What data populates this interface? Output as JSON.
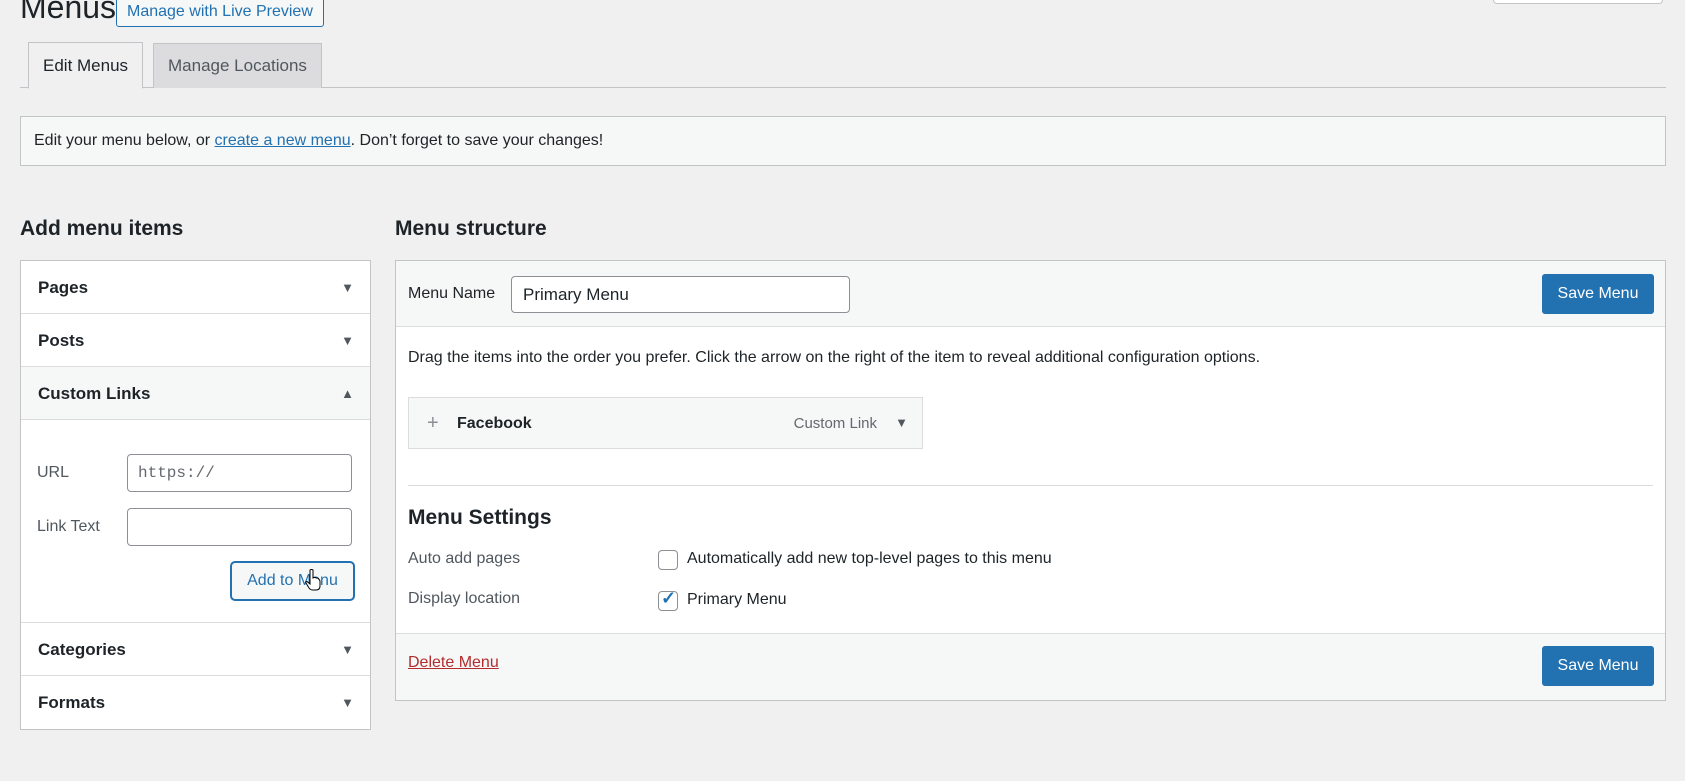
{
  "header": {
    "title": "Menus",
    "live_preview_label": "Manage with Live Preview"
  },
  "tabs": [
    {
      "label": "Edit Menus",
      "active": true
    },
    {
      "label": "Manage Locations",
      "active": false
    }
  ],
  "notice": {
    "prefix": "Edit your menu below, or ",
    "link": "create a new menu",
    "suffix": ". Don’t forget to save your changes!"
  },
  "add_items": {
    "title": "Add menu items",
    "sections": {
      "pages": "Pages",
      "posts": "Posts",
      "custom_links": "Custom Links",
      "categories": "Categories",
      "formats": "Formats"
    },
    "custom_links": {
      "url_label": "URL",
      "url_placeholder": "https://",
      "link_text_label": "Link Text",
      "link_text_value": "",
      "add_button": "Add to Menu"
    }
  },
  "menu_structure": {
    "title": "Menu structure",
    "menu_name_label": "Menu Name",
    "menu_name_value": "Primary Menu",
    "save_label": "Save Menu",
    "instructions": "Drag the items into the order you prefer. Click the arrow on the right of the item to reveal additional configuration options.",
    "items": [
      {
        "title": "Facebook",
        "type": "Custom Link"
      }
    ],
    "settings": {
      "title": "Menu Settings",
      "auto_add_label": "Auto add pages",
      "auto_add_text": "Automatically add new top-level pages to this menu",
      "auto_add_checked": false,
      "display_location_label": "Display location",
      "display_location_text": "Primary Menu",
      "display_location_checked": true
    },
    "delete_label": "Delete Menu"
  },
  "colors": {
    "accent": "#2271b1",
    "danger": "#b32d2e",
    "background": "#f0f0f1"
  }
}
